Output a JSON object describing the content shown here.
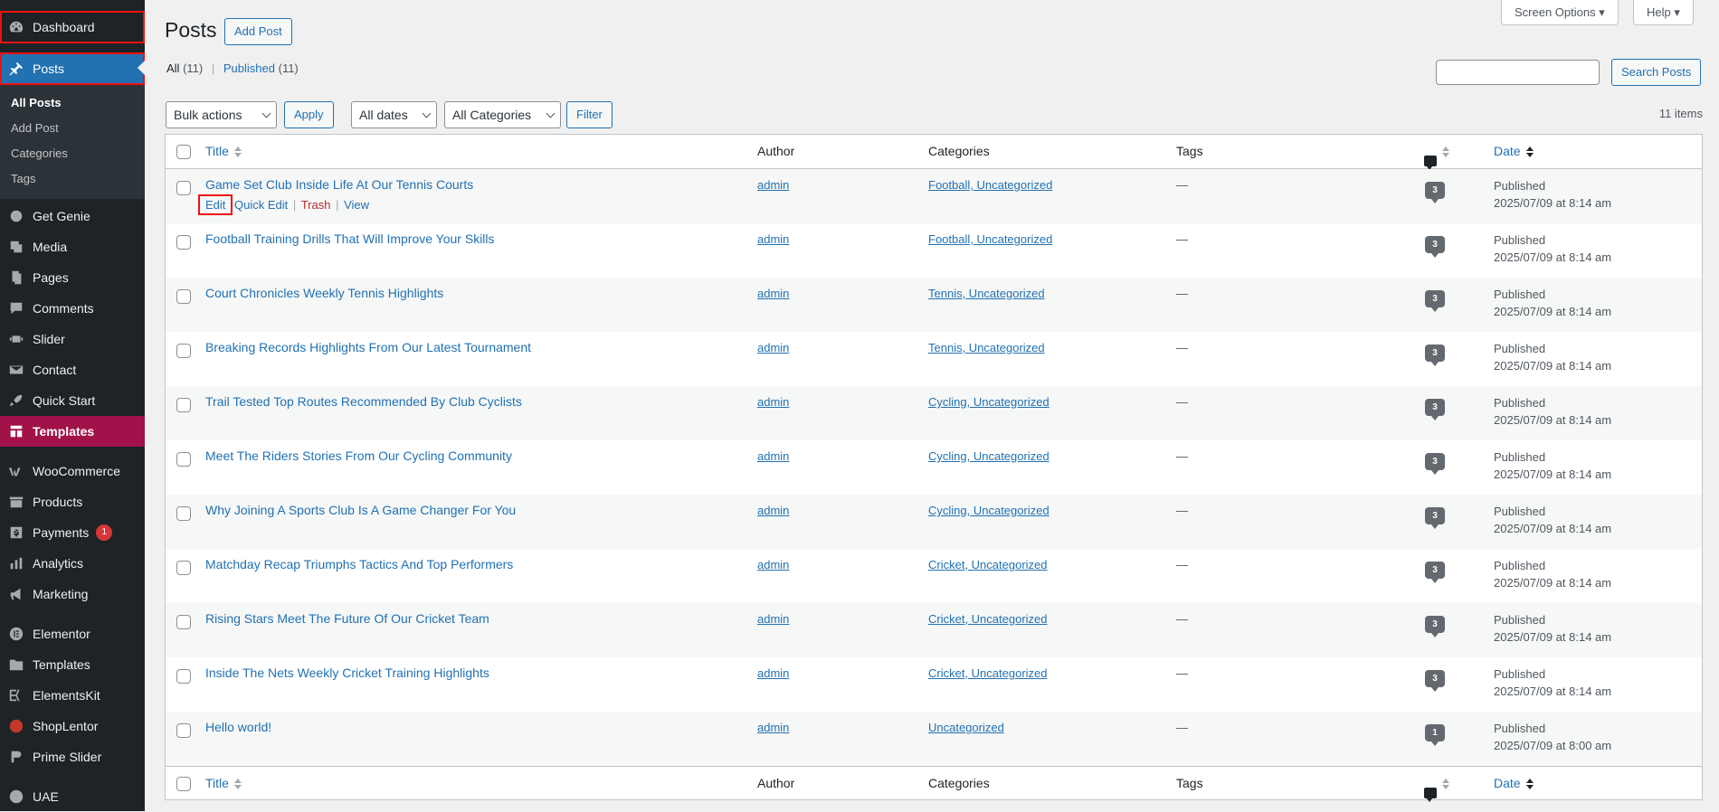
{
  "sidebar": {
    "dashboard": "Dashboard",
    "posts": "Posts",
    "sub": [
      "All Posts",
      "Add Post",
      "Categories",
      "Tags"
    ],
    "items_a": [
      "Get Genie",
      "Media",
      "Pages",
      "Comments",
      "Slider",
      "Contact",
      "Quick Start"
    ],
    "templates_hl": "Templates",
    "items_b": [
      "WooCommerce",
      "Products",
      "Payments",
      "Analytics",
      "Marketing"
    ],
    "payments_badge": "1",
    "items_c": [
      "Elementor",
      "Templates",
      "ElementsKit",
      "ShopLentor",
      "Prime Slider"
    ],
    "uae": "UAE"
  },
  "header": {
    "title": "Posts",
    "add_post": "Add Post",
    "screen_options": "Screen Options",
    "help": "Help"
  },
  "views": {
    "all": "All",
    "all_count": "(11)",
    "published": "Published",
    "published_count": "(11)",
    "separator": "|"
  },
  "search": {
    "button": "Search Posts",
    "value": ""
  },
  "filters": {
    "bulk": "Bulk actions",
    "apply": "Apply",
    "dates": "All dates",
    "categories": "All Categories",
    "filter": "Filter",
    "items": "11 items"
  },
  "columns": {
    "title": "Title",
    "author": "Author",
    "categories": "Categories",
    "tags": "Tags",
    "date": "Date"
  },
  "row_actions": {
    "edit": "Edit",
    "quick_edit": "Quick Edit",
    "trash": "Trash",
    "view": "View",
    "sep": "|"
  },
  "posts": [
    {
      "title": "Game Set Club Inside Life At Our Tennis Courts",
      "author": "admin",
      "categories": "Football, Uncategorized",
      "tags": "—",
      "comments": "3",
      "status": "Published",
      "date": "2025/07/09 at 8:14 am"
    },
    {
      "title": "Football Training Drills That Will Improve Your Skills",
      "author": "admin",
      "categories": "Football, Uncategorized",
      "tags": "—",
      "comments": "3",
      "status": "Published",
      "date": "2025/07/09 at 8:14 am"
    },
    {
      "title": "Court Chronicles Weekly Tennis Highlights",
      "author": "admin",
      "categories": "Tennis, Uncategorized",
      "tags": "—",
      "comments": "3",
      "status": "Published",
      "date": "2025/07/09 at 8:14 am"
    },
    {
      "title": "Breaking Records Highlights From Our Latest Tournament",
      "author": "admin",
      "categories": "Tennis, Uncategorized",
      "tags": "—",
      "comments": "3",
      "status": "Published",
      "date": "2025/07/09 at 8:14 am"
    },
    {
      "title": "Trail Tested Top Routes Recommended By Club Cyclists",
      "author": "admin",
      "categories": "Cycling, Uncategorized",
      "tags": "—",
      "comments": "3",
      "status": "Published",
      "date": "2025/07/09 at 8:14 am"
    },
    {
      "title": "Meet The Riders Stories From Our Cycling Community",
      "author": "admin",
      "categories": "Cycling, Uncategorized",
      "tags": "—",
      "comments": "3",
      "status": "Published",
      "date": "2025/07/09 at 8:14 am"
    },
    {
      "title": "Why Joining A Sports Club Is A Game Changer For You",
      "author": "admin",
      "categories": "Cycling, Uncategorized",
      "tags": "—",
      "comments": "3",
      "status": "Published",
      "date": "2025/07/09 at 8:14 am"
    },
    {
      "title": "Matchday Recap Triumphs Tactics And Top Performers",
      "author": "admin",
      "categories": "Cricket, Uncategorized",
      "tags": "—",
      "comments": "3",
      "status": "Published",
      "date": "2025/07/09 at 8:14 am"
    },
    {
      "title": "Rising Stars Meet The Future Of Our Cricket Team",
      "author": "admin",
      "categories": "Cricket, Uncategorized",
      "tags": "—",
      "comments": "3",
      "status": "Published",
      "date": "2025/07/09 at 8:14 am"
    },
    {
      "title": "Inside The Nets Weekly Cricket Training Highlights",
      "author": "admin",
      "categories": "Cricket, Uncategorized",
      "tags": "—",
      "comments": "3",
      "status": "Published",
      "date": "2025/07/09 at 8:14 am"
    },
    {
      "title": "Hello world!",
      "author": "admin",
      "categories": "Uncategorized",
      "tags": "—",
      "comments": "1",
      "status": "Published",
      "date": "2025/07/09 at 8:00 am"
    }
  ],
  "colors": {
    "accent": "#2271b1",
    "sidebar": "#1d2327",
    "templates": "#a2124a",
    "danger": "#b32d2e"
  }
}
